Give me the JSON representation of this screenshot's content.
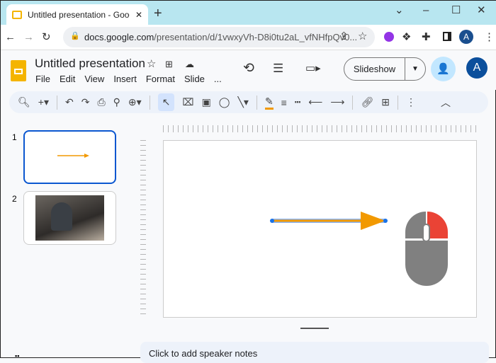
{
  "browser": {
    "tab_title": "Untitled presentation - Google Sl",
    "url_domain": "docs.google.com",
    "url_path": "/presentation/d/1vwxyVh-D8i0tu2aL_vfNHfpQv0...",
    "profile_initial": "A"
  },
  "doc": {
    "title": "Untitled presentation",
    "menu": [
      "File",
      "Edit",
      "View",
      "Insert",
      "Format",
      "Slide",
      "..."
    ],
    "slideshow_label": "Slideshow",
    "account_initial": "A"
  },
  "slides": [
    {
      "number": "1",
      "content": "arrow"
    },
    {
      "number": "2",
      "content": "photo"
    }
  ],
  "notes": {
    "placeholder": "Click to add speaker notes"
  },
  "colors": {
    "arrow": "#f29900",
    "accent": "#1a73e8",
    "mouse_button": "#ea4335",
    "mouse_body": "#808080"
  }
}
